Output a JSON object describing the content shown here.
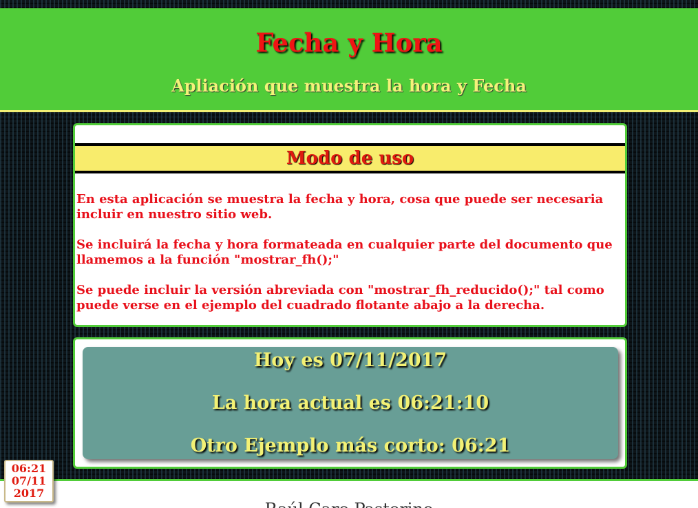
{
  "header": {
    "title": "Fecha y Hora",
    "subtitle": "Apliación que muestra la hora y Fecha"
  },
  "usage": {
    "title": "Modo de uso",
    "paragraphs": [
      "En esta aplicación se muestra la fecha y hora, cosa que puede ser necesaria incluir en nuestro sitio web.",
      "Se incluirá la fecha y hora formateada en cualquier parte del documento que llamemos a la función \"mostrar_fh();\"",
      "Se puede incluir la versión abreviada con \"mostrar_fh_reducido();\" tal como puede verse en el ejemplo del cuadrado flotante abajo a la derecha."
    ]
  },
  "clock": {
    "date_line": "Hoy es 07/11/2017",
    "time_line": "La hora actual es 06:21:10",
    "short_line": "Otro Ejemplo más corto: 06:21"
  },
  "mini_clock": {
    "time": "06:21",
    "date": "07/11",
    "year": "2017"
  },
  "footer": {
    "author": "Raúl Caro Pastorino"
  },
  "colors": {
    "header_green": "#51cc39",
    "title_red": "#f01414",
    "accent_yellow": "#f4f27a",
    "clock_teal": "#689e96"
  }
}
